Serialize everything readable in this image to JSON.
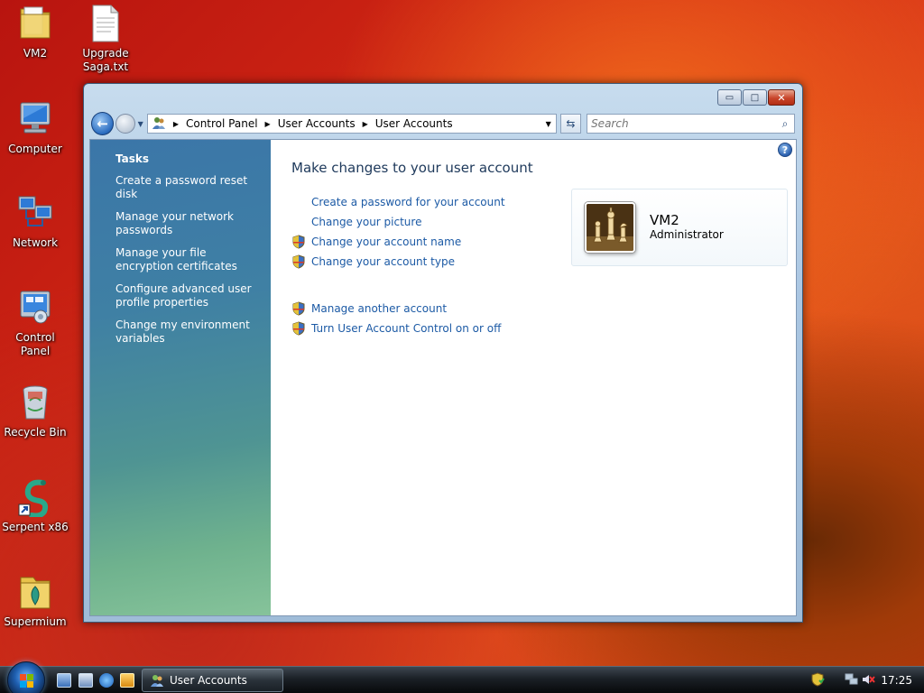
{
  "desktop": {
    "icons": [
      {
        "label": "VM2",
        "icon": "folder-icon"
      },
      {
        "label": "Upgrade Saga.txt",
        "icon": "text-file-icon"
      },
      {
        "label": "Computer",
        "icon": "computer-icon"
      },
      {
        "label": "Network",
        "icon": "network-icon"
      },
      {
        "label": "Control Panel",
        "icon": "control-panel-icon"
      },
      {
        "label": "Recycle Bin",
        "icon": "recycle-bin-icon"
      },
      {
        "label": "Serpent x86",
        "icon": "serpent-shortcut-icon"
      },
      {
        "label": "Supermium",
        "icon": "supermium-folder-icon"
      }
    ]
  },
  "window": {
    "caption_buttons": {
      "minimize": "▭",
      "maximize": "□",
      "close": "✕"
    },
    "breadcrumb": [
      "Control Panel",
      "User Accounts",
      "User Accounts"
    ],
    "search_placeholder": "Search",
    "tasks": {
      "heading": "Tasks",
      "items": [
        "Create a password reset disk",
        "Manage your network passwords",
        "Manage your file encryption certificates",
        "Configure advanced user profile properties",
        "Change my environment variables"
      ]
    },
    "main": {
      "title": "Make changes to your user account",
      "links_group1": [
        {
          "label": "Create a password for your account",
          "shield": false
        },
        {
          "label": "Change your picture",
          "shield": false
        },
        {
          "label": "Change your account name",
          "shield": true
        },
        {
          "label": "Change your account type",
          "shield": true
        }
      ],
      "links_group2": [
        {
          "label": "Manage another account",
          "shield": true
        },
        {
          "label": "Turn User Account Control on or off",
          "shield": true
        }
      ]
    },
    "account": {
      "name": "VM2",
      "role": "Administrator",
      "picture": "chess-pieces-picture"
    }
  },
  "taskbar": {
    "active_task": "User Accounts",
    "clock": "17:25"
  },
  "colors": {
    "link": "#1c5aa5",
    "heading": "#1e395b"
  }
}
